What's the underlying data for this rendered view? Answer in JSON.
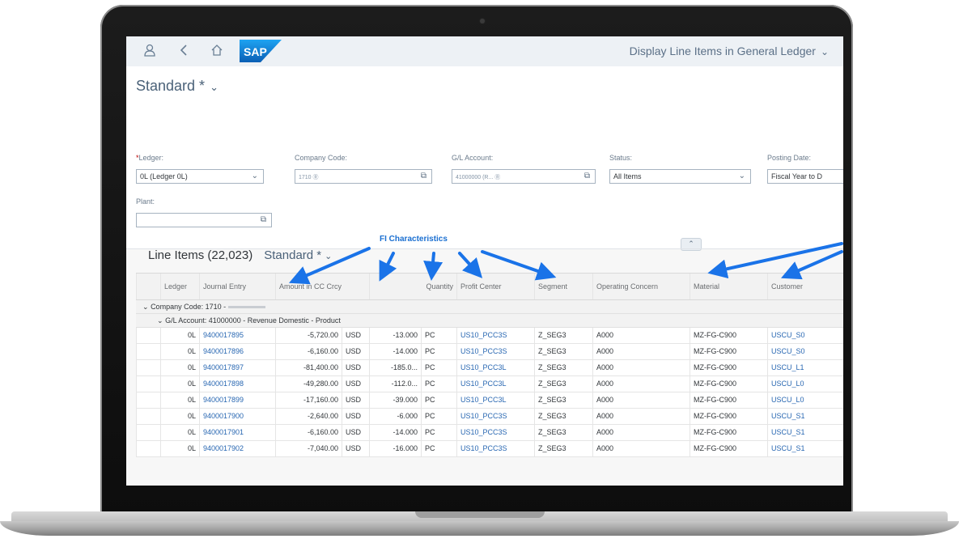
{
  "app": {
    "title": "Display Line Items in General Ledger",
    "logo_text": "SAP"
  },
  "variant": {
    "name": "Standard *"
  },
  "filters": {
    "ledger": {
      "label": "Ledger:",
      "value": "0L (Ledger 0L)"
    },
    "company_code": {
      "label": "Company Code:",
      "value": "1710"
    },
    "gl_account": {
      "label": "G/L Account:",
      "value": "41000000 (R..."
    },
    "status": {
      "label": "Status:",
      "value": "All Items"
    },
    "posting_date": {
      "label": "Posting Date:",
      "value": "Fiscal Year to D"
    },
    "plant": {
      "label": "Plant:",
      "value": ""
    }
  },
  "line_items": {
    "title": "Line Items (22,023)",
    "variant": "Standard *"
  },
  "annotation": {
    "label": "FI Characteristics",
    "color": "#1a73e8"
  },
  "table": {
    "columns": [
      "Ledger",
      "Journal Entry",
      "Amount in CC Crcy",
      "Quantity",
      "Profit Center",
      "Segment",
      "Operating Concern",
      "Material",
      "Customer"
    ],
    "group1": "Company Code: 1710 -",
    "group2": "G/L Account: 41000000 - Revenue Domestic - Product",
    "rows": [
      [
        "0L",
        "9400017895",
        "-5,720.00",
        "USD",
        "-13.000",
        "PC",
        "US10_PCC3S",
        "Z_SEG3",
        "A000",
        "MZ-FG-C900",
        "USCU_S0"
      ],
      [
        "0L",
        "9400017896",
        "-6,160.00",
        "USD",
        "-14.000",
        "PC",
        "US10_PCC3S",
        "Z_SEG3",
        "A000",
        "MZ-FG-C900",
        "USCU_S0"
      ],
      [
        "0L",
        "9400017897",
        "-81,400.00",
        "USD",
        "-185.0...",
        "PC",
        "US10_PCC3L",
        "Z_SEG3",
        "A000",
        "MZ-FG-C900",
        "USCU_L1"
      ],
      [
        "0L",
        "9400017898",
        "-49,280.00",
        "USD",
        "-112.0...",
        "PC",
        "US10_PCC3L",
        "Z_SEG3",
        "A000",
        "MZ-FG-C900",
        "USCU_L0"
      ],
      [
        "0L",
        "9400017899",
        "-17,160.00",
        "USD",
        "-39.000",
        "PC",
        "US10_PCC3L",
        "Z_SEG3",
        "A000",
        "MZ-FG-C900",
        "USCU_L0"
      ],
      [
        "0L",
        "9400017900",
        "-2,640.00",
        "USD",
        "-6.000",
        "PC",
        "US10_PCC3S",
        "Z_SEG3",
        "A000",
        "MZ-FG-C900",
        "USCU_S1"
      ],
      [
        "0L",
        "9400017901",
        "-6,160.00",
        "USD",
        "-14.000",
        "PC",
        "US10_PCC3S",
        "Z_SEG3",
        "A000",
        "MZ-FG-C900",
        "USCU_S1"
      ],
      [
        "0L",
        "9400017902",
        "-7,040.00",
        "USD",
        "-16.000",
        "PC",
        "US10_PCC3S",
        "Z_SEG3",
        "A000",
        "MZ-FG-C900",
        "USCU_S1"
      ]
    ]
  }
}
